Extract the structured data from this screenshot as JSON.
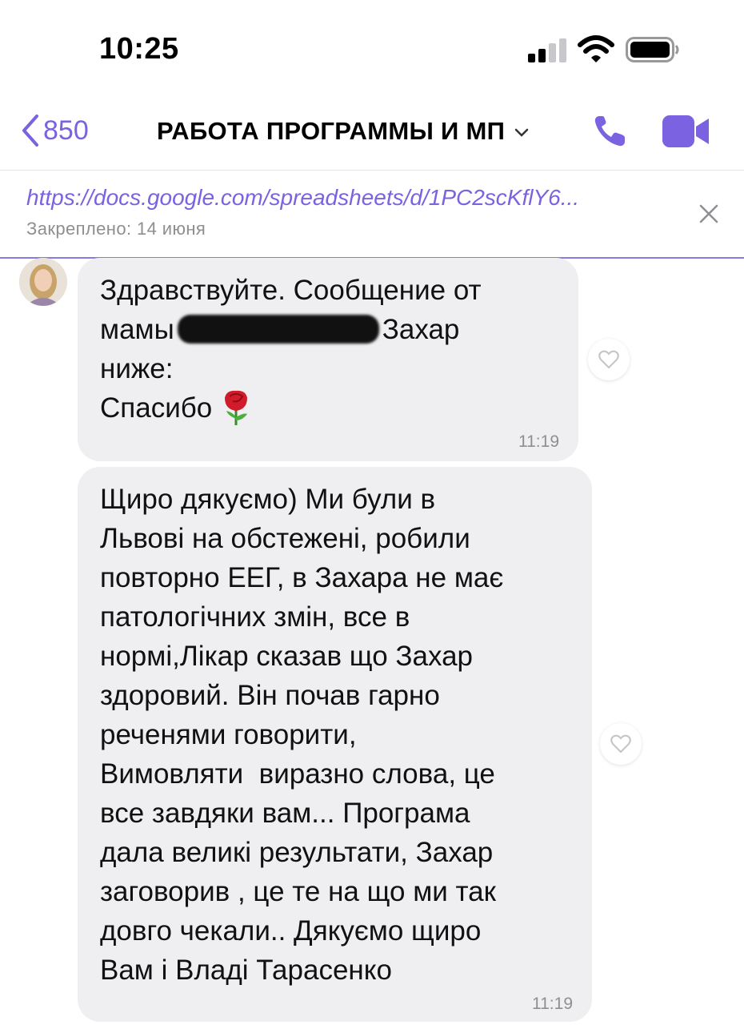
{
  "status_bar": {
    "time": "10:25"
  },
  "nav": {
    "back_count": "850",
    "title": "РАБОТА ПРОГРАММЫ И МП"
  },
  "pinned": {
    "link": "https://docs.google.com/spreadsheets/d/1PC2scKflY6...",
    "meta": "Закреплено: 14 июня"
  },
  "messages": [
    {
      "line1": "Здравствуйте. Сообщение от",
      "line2_a": "мамы",
      "line2_b": "Захар",
      "line3": "ниже:",
      "line4": "Спасибо",
      "time": "11:19"
    },
    {
      "text": "Щиро дякуємо) Ми були в\nЛьвові на обстежені, робили\nповторно ЕЕГ, в Захара не має\nпатологічних змін, все в\nнормі,Лікар сказав що Захар\nздоровий. Він почав гарно\nреченями говорити,\nВимовляти  виразно слова, це\nвсе завдяки вам... Програма\nдала великі результати, Захар\nзаговорив , це те на що ми так\nдовго чекали.. Дякуємо щиро\nВам і Владі Тарасенко",
      "time": "11:19"
    }
  ],
  "colors": {
    "accent": "#7a62e0",
    "bubble": "#efeff1",
    "meta": "#8e8e93"
  },
  "icons": [
    "signal-icon",
    "wifi-icon",
    "battery-icon",
    "back-chevron-icon",
    "chevron-down-icon",
    "phone-icon",
    "video-icon",
    "close-icon",
    "heart-icon",
    "rose-icon"
  ]
}
